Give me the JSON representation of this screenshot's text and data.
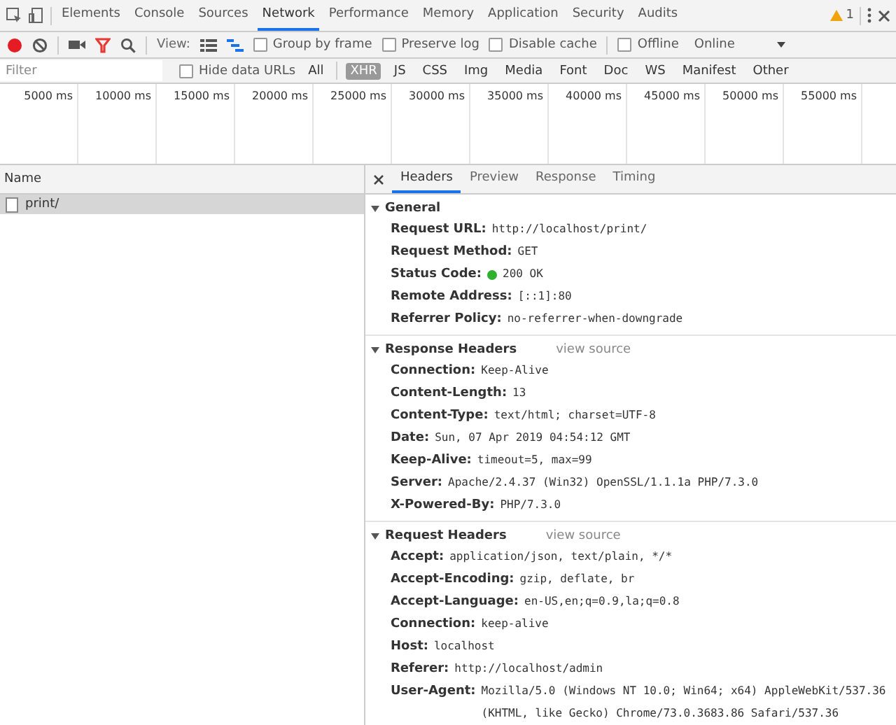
{
  "main_tabs": [
    {
      "label": "Elements",
      "selected": false
    },
    {
      "label": "Console",
      "selected": false
    },
    {
      "label": "Sources",
      "selected": false
    },
    {
      "label": "Network",
      "selected": true
    },
    {
      "label": "Performance",
      "selected": false
    },
    {
      "label": "Memory",
      "selected": false
    },
    {
      "label": "Application",
      "selected": false
    },
    {
      "label": "Security",
      "selected": false
    },
    {
      "label": "Audits",
      "selected": false
    }
  ],
  "warning_count": "1",
  "toolbar": {
    "recording": true,
    "view_label": "View:",
    "large_rows": false,
    "overview": true,
    "checkboxes": [
      {
        "label": "Group by frame",
        "checked": false
      },
      {
        "label": "Preserve log",
        "checked": false
      },
      {
        "label": "Disable cache",
        "checked": false
      },
      {
        "label": "Offline",
        "checked": false
      }
    ],
    "throttling": "Online"
  },
  "filter": {
    "placeholder": "Filter",
    "hide_data_urls": {
      "label": "Hide data URLs",
      "checked": false
    },
    "types": [
      {
        "label": "All",
        "selected": false
      },
      {
        "label": "XHR",
        "selected": true
      },
      {
        "label": "JS",
        "selected": false
      },
      {
        "label": "CSS",
        "selected": false
      },
      {
        "label": "Img",
        "selected": false
      },
      {
        "label": "Media",
        "selected": false
      },
      {
        "label": "Font",
        "selected": false
      },
      {
        "label": "Doc",
        "selected": false
      },
      {
        "label": "WS",
        "selected": false
      },
      {
        "label": "Manifest",
        "selected": false
      },
      {
        "label": "Other",
        "selected": false
      }
    ]
  },
  "timeline_ticks": [
    "5000 ms",
    "10000 ms",
    "15000 ms",
    "20000 ms",
    "25000 ms",
    "30000 ms",
    "35000 ms",
    "40000 ms",
    "45000 ms",
    "50000 ms",
    "55000 ms"
  ],
  "requests": {
    "column": "Name",
    "rows": [
      {
        "name": "print/",
        "selected": true
      }
    ]
  },
  "detail_tabs": [
    {
      "label": "Headers",
      "selected": true
    },
    {
      "label": "Preview",
      "selected": false
    },
    {
      "label": "Response",
      "selected": false
    },
    {
      "label": "Timing",
      "selected": false
    }
  ],
  "sections": [
    {
      "title": "General",
      "expanded": true,
      "rows": [
        {
          "name": "Request URL:",
          "value": "http://localhost/print/"
        },
        {
          "name": "Request Method:",
          "value": "GET"
        },
        {
          "name": "Status Code:",
          "value": "200 OK",
          "color": "#2fb12f"
        },
        {
          "name": "Remote Address:",
          "value": "[::1]:80"
        },
        {
          "name": "Referrer Policy:",
          "value": "no-referrer-when-downgrade"
        }
      ]
    },
    {
      "title": "Response Headers",
      "expanded": true,
      "link": "view source",
      "rows": [
        {
          "name": "Connection:",
          "value": "Keep-Alive"
        },
        {
          "name": "Content-Length:",
          "value": "13"
        },
        {
          "name": "Content-Type:",
          "value": "text/html; charset=UTF-8"
        },
        {
          "name": "Date:",
          "value": "Sun, 07 Apr 2019 04:54:12 GMT"
        },
        {
          "name": "Keep-Alive:",
          "value": "timeout=5, max=99"
        },
        {
          "name": "Server:",
          "value": "Apache/2.4.37 (Win32) OpenSSL/1.1.1a PHP/7.3.0"
        },
        {
          "name": "X-Powered-By:",
          "value": "PHP/7.3.0"
        }
      ]
    },
    {
      "title": "Request Headers",
      "expanded": true,
      "link": "view source",
      "rows": [
        {
          "name": "Accept:",
          "value": "application/json, text/plain, */*"
        },
        {
          "name": "Accept-Encoding:",
          "value": "gzip, deflate, br"
        },
        {
          "name": "Accept-Language:",
          "value": "en-US,en;q=0.9,la;q=0.8"
        },
        {
          "name": "Connection:",
          "value": "keep-alive"
        },
        {
          "name": "Host:",
          "value": "localhost"
        },
        {
          "name": "Referer:",
          "value": "http://localhost/admin"
        },
        {
          "name": "User-Agent:",
          "value": "Mozilla/5.0 (Windows NT 10.0; Win64; x64) AppleWebKit/537.36 (KHTML, like Gecko) Chrome/73.0.3683.86 Safari/537.36"
        }
      ]
    }
  ]
}
